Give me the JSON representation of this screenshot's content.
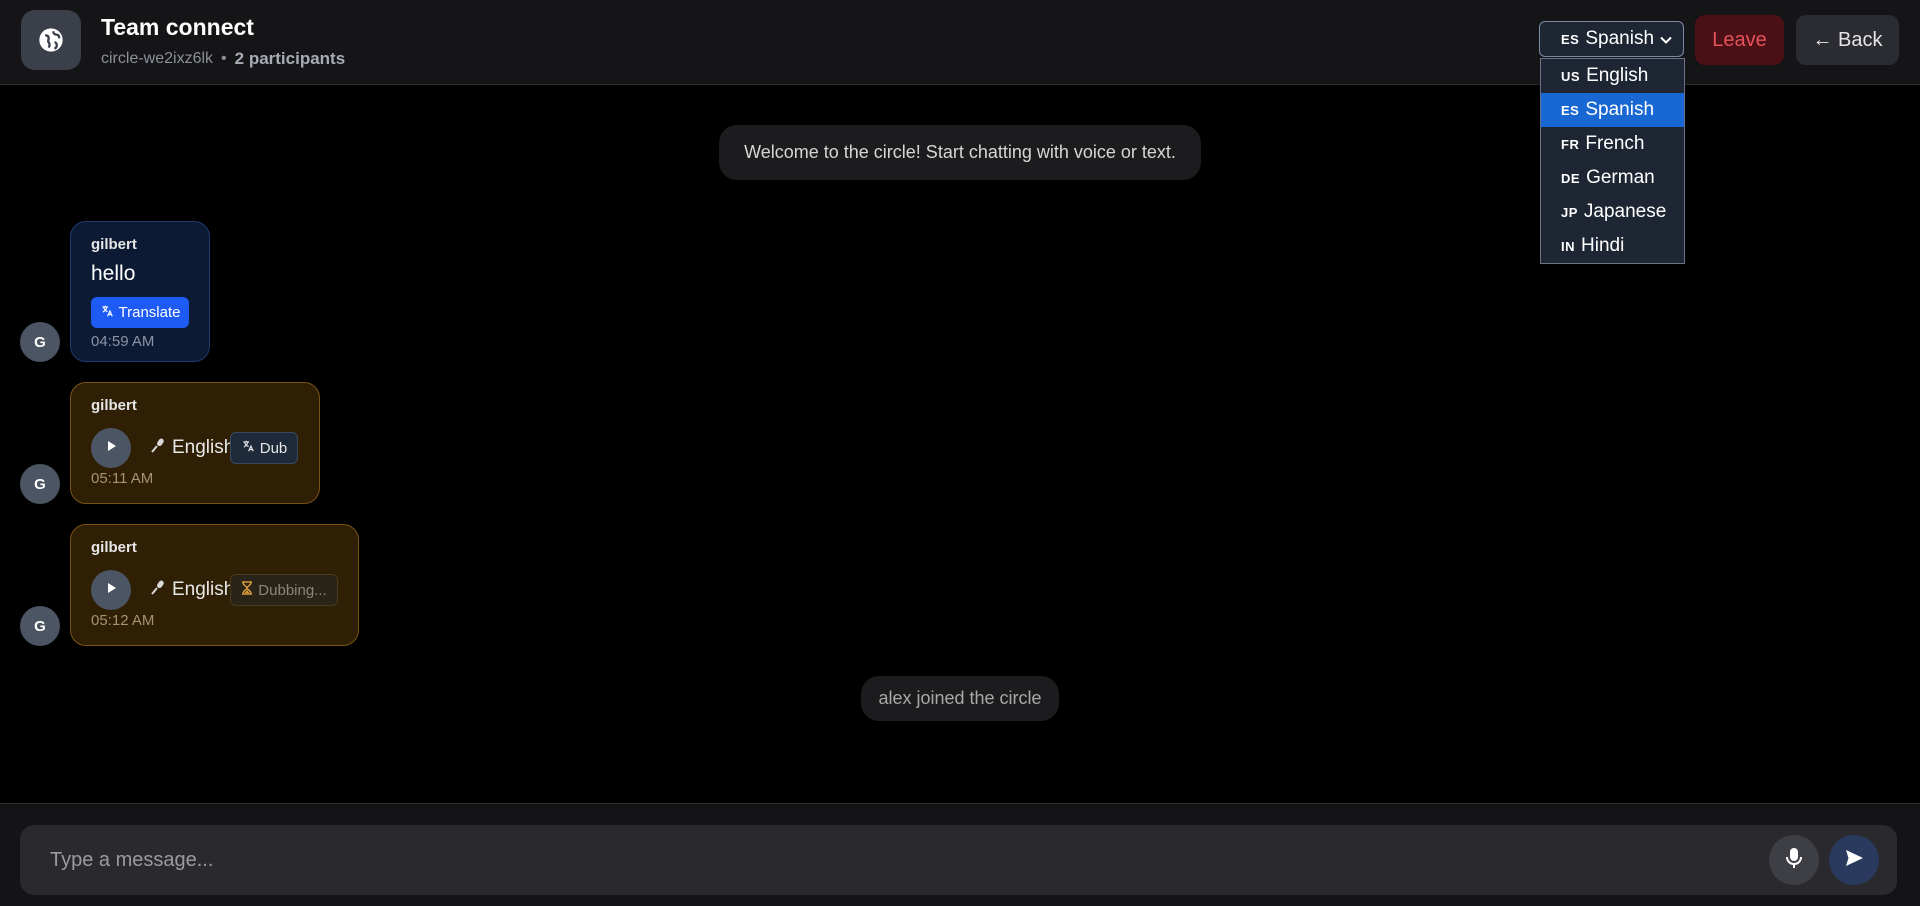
{
  "header": {
    "title": "Team connect",
    "circle_id": "circle-we2ixz6lk",
    "separator": "•",
    "participants": "2 participants",
    "leave_label": "Leave",
    "back_label": "← Back"
  },
  "language_select": {
    "selected_flag": "ES",
    "selected_label": "Spanish",
    "options": [
      {
        "flag": "US",
        "label": "English"
      },
      {
        "flag": "ES",
        "label": "Spanish"
      },
      {
        "flag": "FR",
        "label": "French"
      },
      {
        "flag": "DE",
        "label": "German"
      },
      {
        "flag": "JP",
        "label": "Japanese"
      },
      {
        "flag": "IN",
        "label": "Hindi"
      }
    ]
  },
  "system_messages": {
    "welcome": "Welcome to the circle! Start chatting with voice or text.",
    "joined": "alex joined the circle"
  },
  "messages": [
    {
      "avatar": "G",
      "sender": "gilbert",
      "text": "hello",
      "action": "Translate",
      "time": "04:59 AM"
    },
    {
      "avatar": "G",
      "sender": "gilbert",
      "language": "English",
      "action": "Dub",
      "time": "05:11 AM"
    },
    {
      "avatar": "G",
      "sender": "gilbert",
      "language": "English",
      "action": "Dubbing...",
      "time": "05:12 AM"
    }
  ],
  "composer": {
    "placeholder": "Type a message..."
  },
  "colors": {
    "accent": "#1e5bf5",
    "leave": "#e5525b",
    "voice_bubble": "#2e1f05",
    "text_bubble": "#0c1a33"
  }
}
